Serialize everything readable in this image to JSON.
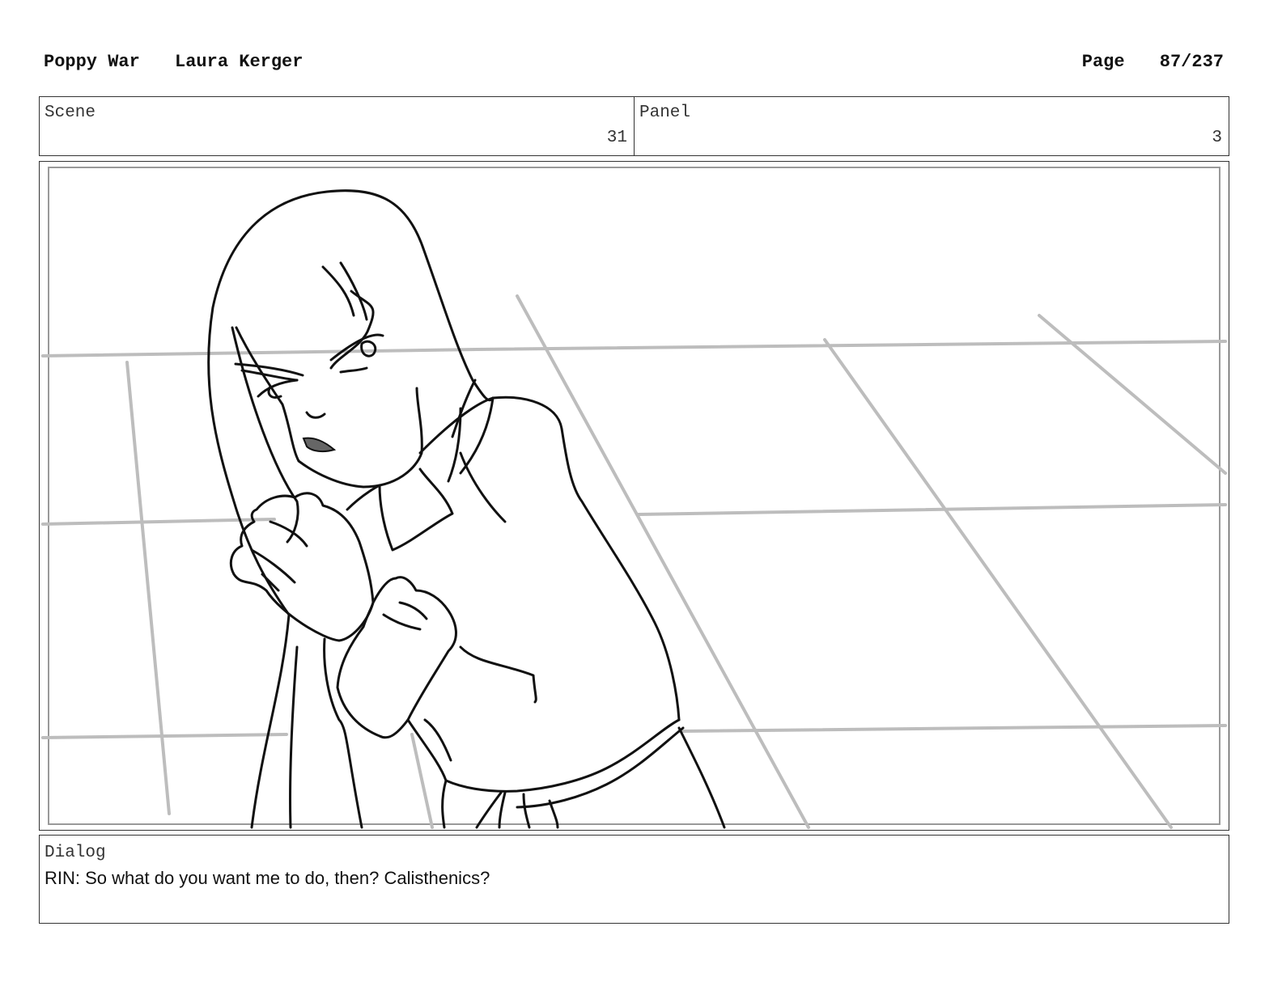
{
  "header": {
    "title": "Poppy War",
    "author": "Laura Kerger",
    "page_label": "Page",
    "page_number": "87/237"
  },
  "scene": {
    "label": "Scene",
    "value": "31"
  },
  "panel": {
    "label": "Panel",
    "value": "3"
  },
  "dialog": {
    "label": "Dialog",
    "text": "RIN: So what do you want me to do, then? Calisthenics?"
  }
}
